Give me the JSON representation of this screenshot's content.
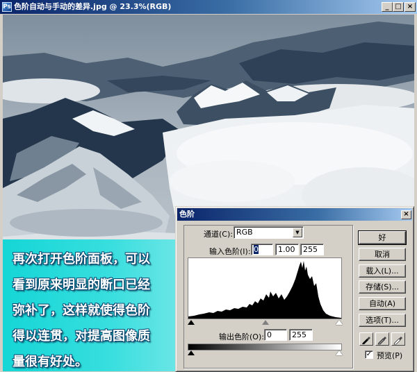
{
  "window": {
    "title": "色阶自动与手动的差异.jpg @ 23.3%(RGB)",
    "minimize": "_",
    "maximize": "□",
    "close": "×"
  },
  "caption": {
    "lines": [
      "再次打开色阶面板，可以",
      "看到原来明显的断口已经",
      "弥补了，这样就使得色阶",
      "得以连贯，对提高图像质",
      "量很有好处。"
    ]
  },
  "dialog": {
    "title": "色阶",
    "close": "×",
    "channel_label": "通道(C):",
    "channel_value": "RGB",
    "input_label": "输入色阶(I):",
    "input_black": "0",
    "input_gamma": "1.00",
    "input_white": "255",
    "output_label": "输出色阶(O):",
    "output_black": "0",
    "output_white": "255",
    "buttons": {
      "ok": "好",
      "cancel": "取消",
      "load": "载入(L)...",
      "save": "存储(S)...",
      "auto": "自动(A)",
      "options": "选项(T)..."
    },
    "preview_label": "预览(P)",
    "preview_checked": "✓"
  },
  "colors": {
    "titlebar_start": "#0a246a",
    "caption_bg": "#20d8d8",
    "caption_text_outline": "#0c4a72",
    "dialog_face": "#d4d0c8"
  }
}
